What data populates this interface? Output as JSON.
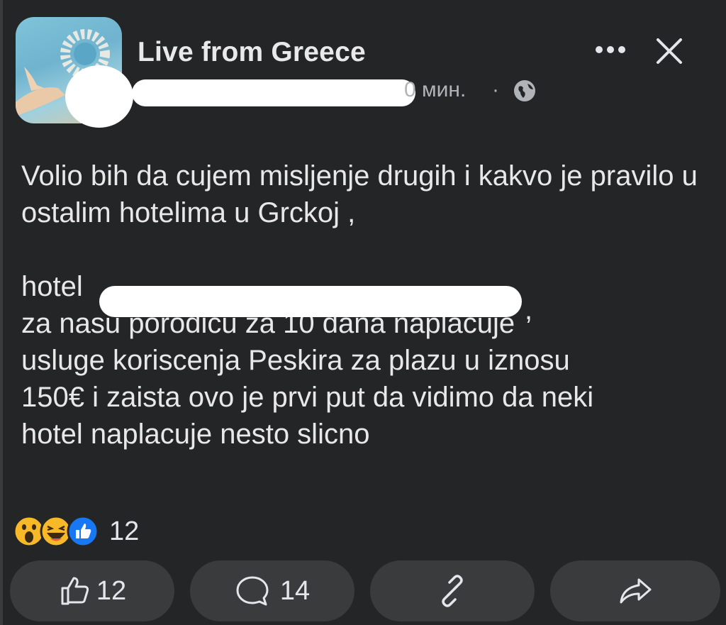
{
  "post": {
    "page_name": "Live from Greece",
    "timestamp": "0 мин.",
    "separator": "·",
    "paragraphs": [
      "Volio bih da cujem misljenje drugih  i kakvo je pravilo u ostalim hotelima u Grckoj ,"
    ],
    "hotel_prefix": "hotel",
    "hotel_suffix": ",",
    "body_lines": [
      "za nasu porodicu za 10 dana naplacuje",
      "usluge koriscenja Peskira za plazu u iznosu",
      "150€ i zaista ovo je prvi put da vidimo da neki",
      "hotel naplacuje nesto slicno"
    ]
  },
  "reactions": {
    "icons": [
      "wow-icon",
      "haha-icon",
      "like-icon"
    ],
    "count": "12"
  },
  "actions": {
    "like_count": "12",
    "comment_count": "14"
  },
  "colors": {
    "background": "#242526",
    "button": "#3a3b3c",
    "text": "#e4e6eb",
    "muted": "#b0b3b8",
    "like_blue": "#1877f2",
    "reaction_yellow": "#f7b928"
  }
}
